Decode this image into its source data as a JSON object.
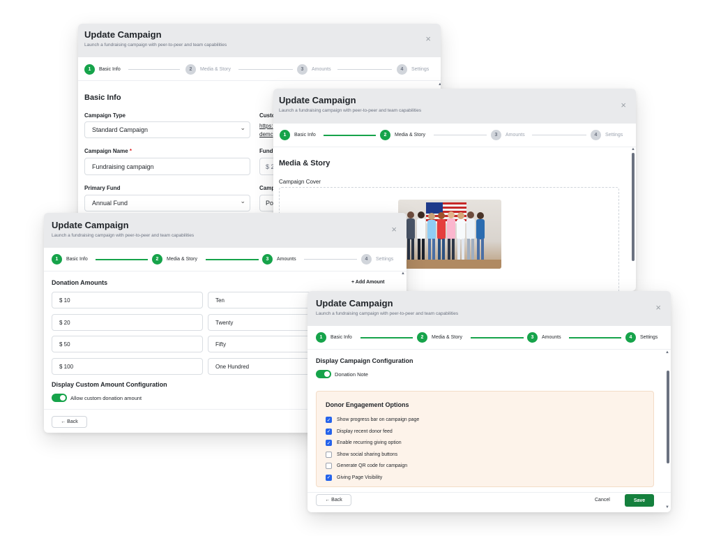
{
  "steps": [
    "Basic Info",
    "Media & Story",
    "Amounts",
    "Settings"
  ],
  "common": {
    "title": "Update Campaign",
    "subtitle": "Launch a fundraising campaign with peer-to-peer and team capabilities",
    "back_label": "← Back",
    "close_glyph": "×",
    "select_caret": "⌄"
  },
  "panel1": {
    "section": "Basic Info",
    "campaign_type_label": "Campaign Type",
    "campaign_type_value": "Standard Campaign",
    "campaign_name_label": "Campaign Name",
    "required_mark": "*",
    "campaign_name_value": "Fundraising campaign",
    "primary_fund_label": "Primary Fund",
    "primary_fund_value": "Annual Fund",
    "right_label_1": "Custo",
    "right_link_1": "https:",
    "right_link_2": "demc",
    "right_label_2": "Fundr",
    "right_value_2": "$ 2",
    "right_label_3": "Camp",
    "right_value_3": "Pol"
  },
  "panel2": {
    "section": "Media & Story",
    "cover_label": "Campaign Cover"
  },
  "panel3": {
    "section": "Donation Amounts",
    "add_amount": "+ Add Amount",
    "amounts": [
      {
        "amount": "$ 10",
        "label": "Ten"
      },
      {
        "amount": "$ 20",
        "label": "Twenty"
      },
      {
        "amount": "$ 50",
        "label": "Fifty"
      },
      {
        "amount": "$ 100",
        "label": "One Hundred"
      }
    ],
    "custom_section": "Display Custom Amount Configuration",
    "custom_toggle_label": "Allow custom donation amount"
  },
  "panel4": {
    "section": "Display Campaign Configuration",
    "donation_note": "Donation Note",
    "engagement_title": "Donor Engagement Options",
    "options": [
      {
        "label": "Show progress bar on campaign page",
        "checked": true
      },
      {
        "label": "Display recent donor feed",
        "checked": true
      },
      {
        "label": "Enable recurring giving option",
        "checked": true
      },
      {
        "label": "Show social sharing buttons",
        "checked": false
      },
      {
        "label": "Generate QR code for campaign",
        "checked": false
      },
      {
        "label": "Giving Page Visibility",
        "checked": true
      }
    ],
    "cancel_label": "Cancel",
    "save_label": "Save"
  },
  "colors": {
    "accent_green": "#16a34a",
    "checkbox_blue": "#2563eb",
    "engagement_bg": "#fdf3ea"
  }
}
